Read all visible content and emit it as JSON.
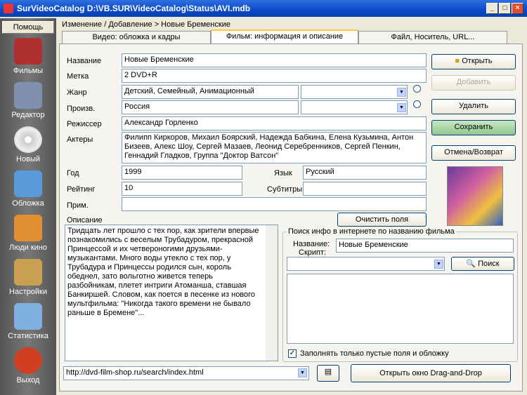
{
  "window": {
    "title": "SurVideoCatalog D:\\VB.SUR\\VideoCatalog\\Status\\AVI.mdb"
  },
  "sidebar": {
    "help": "Помощь",
    "items": [
      {
        "label": "Фильмы",
        "icon": "film-icon"
      },
      {
        "label": "Редактор",
        "icon": "editor-icon"
      },
      {
        "label": "Новый",
        "icon": "disc-icon"
      },
      {
        "label": "Обложка",
        "icon": "cover-icon"
      },
      {
        "label": "Люди кино",
        "icon": "people-icon"
      },
      {
        "label": "Настройки",
        "icon": "settings-icon"
      },
      {
        "label": "Статистика",
        "icon": "stats-icon"
      },
      {
        "label": "Выход",
        "icon": "exit-icon"
      }
    ]
  },
  "breadcrumb": "Изменение / Добавление > Новые Бременские",
  "tabs": [
    "Видео: обложка и кадры",
    "Фильм: информация и описание",
    "Файл, Носитель, URL..."
  ],
  "form": {
    "title_label": "Название",
    "title": "Новые Бременские",
    "tag_label": "Метка",
    "tag": "2 DVD+R",
    "genre_label": "Жанр",
    "genre": "Детский, Семейный, Анимационный",
    "country_label": "Произв.",
    "country": "Россия",
    "director_label": "Режиссер",
    "director": "Александр Горленко",
    "actors_label": "Актеры",
    "actors": "Филипп Киркоров, Михаил Боярский, Надежда Бабкина, Елена Кузьмина, Антон Бизеев, Алекс Шоу, Сергей Мазаев, Леонид Серебренников, Сергей Пенкин, Геннадий Гладков, Группа \"Доктор Ватсон\"",
    "year_label": "Год",
    "year": "1999",
    "rating_label": "Рейтинг",
    "rating": "10",
    "language_label": "Язык",
    "language": "Русский",
    "subtitles_label": "Субтитры",
    "subtitles": "",
    "note_label": "Прим.",
    "note": "",
    "desc_label": "Описание",
    "description": "Тридцать лет прошло с тех пор, как зрители впервые познакомились с веселым Трубадуром, прекрасной Принцессой и их четвероногими друзьями-музыкантами. Много воды утекло с тех пор, у Трубадура и Принцессы родился сын, король обеднел, зато вольготно живется теперь разбойникам, плетет интриги Атоманша, ставшая Банкиршей. Словом, как поется в песенке из нового мультфильма: \"Никогда такого времени не бывало раньше в Бремене\"..."
  },
  "buttons": {
    "open": "Открыть",
    "add": "Добавить",
    "delete": "Удалить",
    "save": "Сохранить",
    "cancel": "Отмена/Возврат",
    "clear": "Очистить поля",
    "search": "Поиск",
    "dnd": "Открыть окно Drag-and-Drop"
  },
  "search": {
    "group": "Поиск инфо в интернете по названию фильма",
    "name_label": "Название:",
    "script_label": "Скрипт:",
    "name": "Новые Бременские",
    "script": "",
    "only_empty": "Заполнять только пустые поля и обложку",
    "only_empty_checked": true
  },
  "url": "http://dvd-film-shop.ru/search/index.html"
}
